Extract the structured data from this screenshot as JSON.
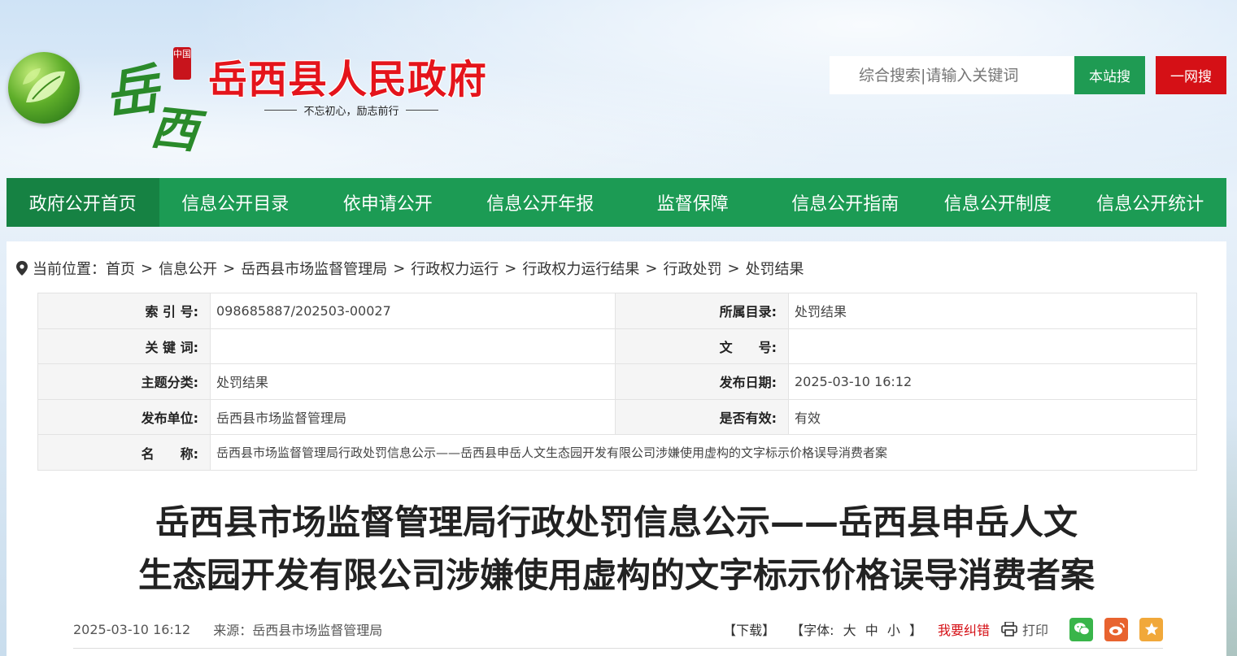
{
  "header": {
    "logo_chars": [
      "岳",
      "西"
    ],
    "seal_text": "中国",
    "site_title": "岳西县人民政府",
    "slogan": "不忘初心，励志前行",
    "search": {
      "placeholder": "综合搜索|请输入关键词",
      "local_btn": "本站搜",
      "all_btn": "一网搜"
    }
  },
  "nav": [
    {
      "label": "政府公开首页",
      "active": true
    },
    {
      "label": "信息公开目录"
    },
    {
      "label": "依申请公开"
    },
    {
      "label": "信息公开年报"
    },
    {
      "label": "监督保障"
    },
    {
      "label": "信息公开指南"
    },
    {
      "label": "信息公开制度"
    },
    {
      "label": "信息公开统计"
    }
  ],
  "breadcrumb": {
    "prefix": "当前位置：",
    "items": [
      "首页",
      "信息公开",
      "岳西县市场监督管理局",
      "行政权力运行",
      "行政权力运行结果",
      "行政处罚",
      "处罚结果"
    ],
    "separator": ">"
  },
  "meta": {
    "index_label": "索 引 号:",
    "index_value": "098685887/202503-00027",
    "catalog_label": "所属目录:",
    "catalog_value": "处罚结果",
    "keyword_label": "关 键 词:",
    "keyword_value": "",
    "doc_no_label": "文　　号:",
    "doc_no_value": "",
    "topic_label": "主题分类:",
    "topic_value": "处罚结果",
    "pub_date_label": "发布日期:",
    "pub_date_value": "2025-03-10 16:12",
    "publisher_label": "发布单位:",
    "publisher_value": "岳西县市场监督管理局",
    "valid_label": "是否有效:",
    "valid_value": "有效",
    "name_label": "名　　称:",
    "name_value": "岳西县市场监督管理局行政处罚信息公示——岳西县申岳人文生态园开发有限公司涉嫌使用虚构的文字标示价格误导消费者案"
  },
  "article": {
    "title_line1": "岳西县市场监督管理局行政处罚信息公示——岳西县申岳人文",
    "title_line2": "生态园开发有限公司涉嫌使用虚构的文字标示价格误导消费者案",
    "date": "2025-03-10 16:12",
    "source": "来源：岳西县市场监督管理局",
    "download": "【下载】",
    "font_label": "【字体:",
    "font_large": "大",
    "font_medium": "中",
    "font_small": "小",
    "font_close": "】",
    "report": "我要纠错",
    "print": "打印"
  },
  "colors": {
    "green": "#1c9b54",
    "red": "#d51016",
    "title_red": "#e4141b"
  }
}
